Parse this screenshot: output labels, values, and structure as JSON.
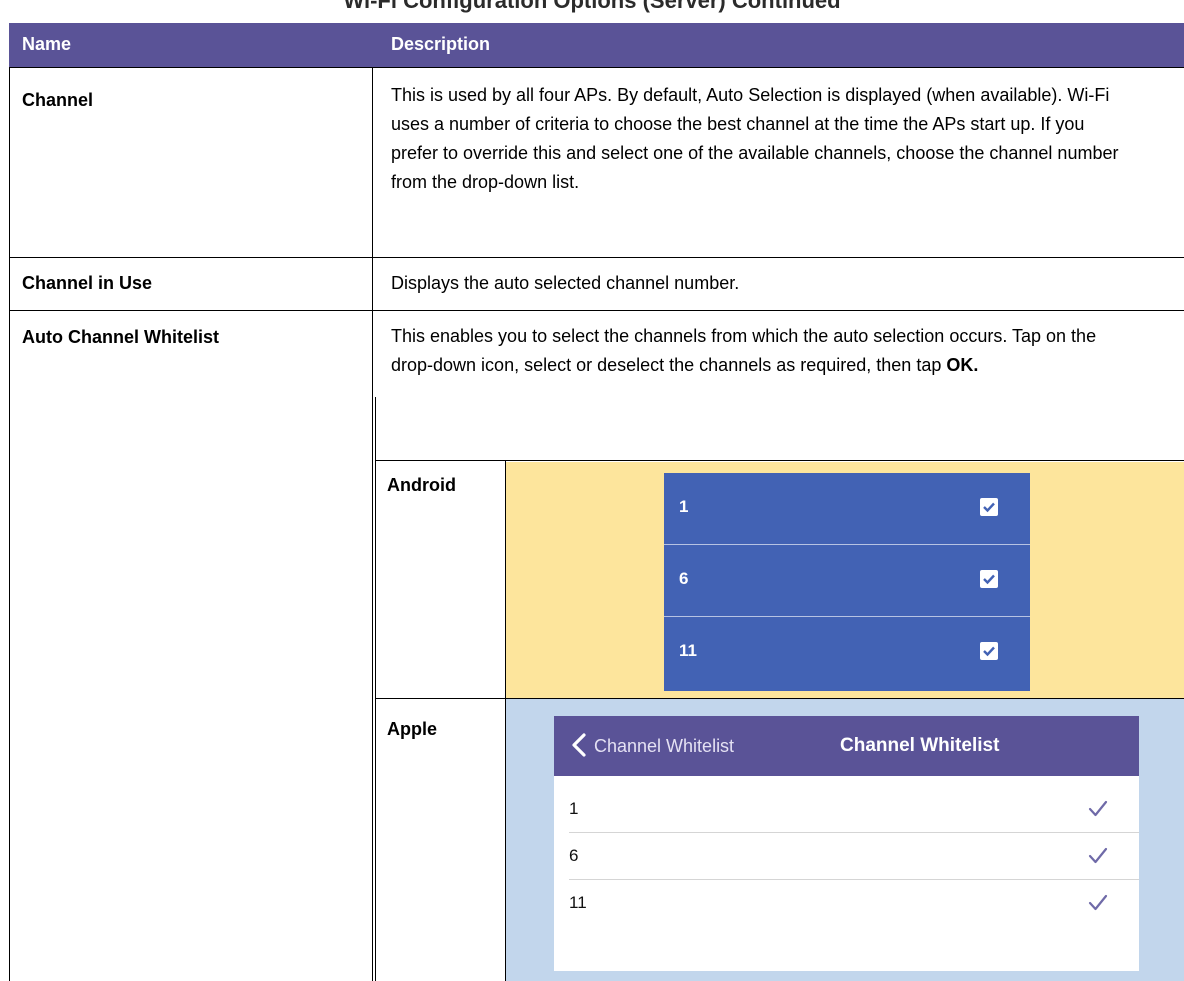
{
  "page_title": "Wi-Fi Configuration Options (Server) Continued",
  "table": {
    "header": {
      "name": "Name",
      "description": "Description"
    },
    "rows": [
      {
        "name": "Channel",
        "description": "This is used by all four APs. By default, Auto Selection is displayed (when available). Wi-Fi uses a number of criteria to choose the best channel at the time the APs start up. If you prefer to override this and select one of the available channels, choose the channel number from the drop-down list."
      },
      {
        "name": "Channel in Use",
        "description": "Displays the auto selected channel number."
      },
      {
        "name": "Auto Channel Whitelist",
        "description_prefix": "This enables you to select the channels from which the auto selection occurs. Tap on the drop-down icon, select or deselect the channels as required, then tap ",
        "description_bold": "OK."
      }
    ]
  },
  "android": {
    "label": "Android",
    "channels": [
      "1",
      "6",
      "11"
    ],
    "checked": [
      true,
      true,
      true
    ],
    "colors": {
      "background": "#fde59c",
      "panel": "#4262b4"
    },
    "icon": "checkbox-checked-icon"
  },
  "apple": {
    "label": "Apple",
    "nav": {
      "back_label": "Channel Whitelist",
      "title": "Channel Whitelist"
    },
    "channels": [
      "1",
      "6",
      "11"
    ],
    "checked": [
      true,
      true,
      true
    ],
    "colors": {
      "background": "#c2d6ec",
      "nav": "#5a5397",
      "check": "#6f6aa8"
    },
    "icons": [
      "chevron-left-icon",
      "checkmark-icon"
    ]
  },
  "colors": {
    "header": "#5a5397"
  }
}
